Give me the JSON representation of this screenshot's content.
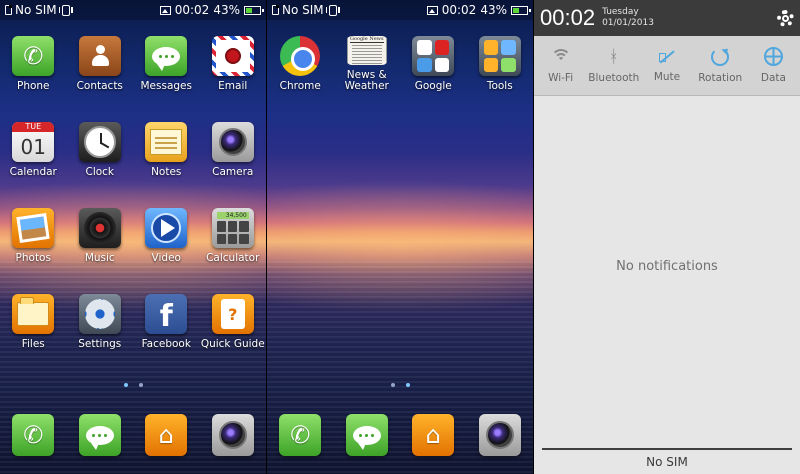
{
  "status": {
    "carrier": "No SIM",
    "time": "00:02",
    "battery": "43%",
    "battery_level": 0.43
  },
  "home1": {
    "apps": [
      {
        "label": "Phone",
        "icon": "phone-icon"
      },
      {
        "label": "Contacts",
        "icon": "contacts-icon"
      },
      {
        "label": "Messages",
        "icon": "messages-icon"
      },
      {
        "label": "Email",
        "icon": "email-icon"
      },
      {
        "label": "Calendar",
        "icon": "calendar-icon",
        "day": "TUE",
        "date": "01"
      },
      {
        "label": "Clock",
        "icon": "clock-icon"
      },
      {
        "label": "Notes",
        "icon": "notes-icon"
      },
      {
        "label": "Camera",
        "icon": "camera-icon"
      },
      {
        "label": "Photos",
        "icon": "photos-icon"
      },
      {
        "label": "Music",
        "icon": "music-icon"
      },
      {
        "label": "Video",
        "icon": "video-icon"
      },
      {
        "label": "Calculator",
        "icon": "calculator-icon"
      },
      {
        "label": "Files",
        "icon": "files-icon"
      },
      {
        "label": "Settings",
        "icon": "settings-icon"
      },
      {
        "label": "Facebook",
        "icon": "facebook-icon"
      },
      {
        "label": "Quick Guide",
        "icon": "quick-guide-icon"
      }
    ]
  },
  "home2": {
    "apps": [
      {
        "label": "Chrome",
        "icon": "chrome-icon"
      },
      {
        "label": "News & Weather",
        "icon": "news-weather-icon"
      },
      {
        "label": "Google",
        "icon": "google-folder-icon"
      },
      {
        "label": "Tools",
        "icon": "tools-folder-icon"
      }
    ]
  },
  "dock": [
    "phone-icon",
    "messages-icon",
    "home-icon",
    "camera-icon"
  ],
  "shade": {
    "time": "00:02",
    "weekday": "Tuesday",
    "date": "01/01/2013",
    "toggles": [
      {
        "label": "Wi-Fi",
        "icon": "wifi-icon"
      },
      {
        "label": "Bluetooth",
        "icon": "bluetooth-icon"
      },
      {
        "label": "Mute",
        "icon": "mute-icon"
      },
      {
        "label": "Rotation",
        "icon": "rotation-icon"
      },
      {
        "label": "Data",
        "icon": "data-icon"
      }
    ],
    "empty_text": "No notifications",
    "footer_text": "No SIM"
  },
  "colors": {
    "accent": "#4fa7dd",
    "shade_header": "#3b3b3b",
    "shade_body": "#e6e6e6"
  }
}
